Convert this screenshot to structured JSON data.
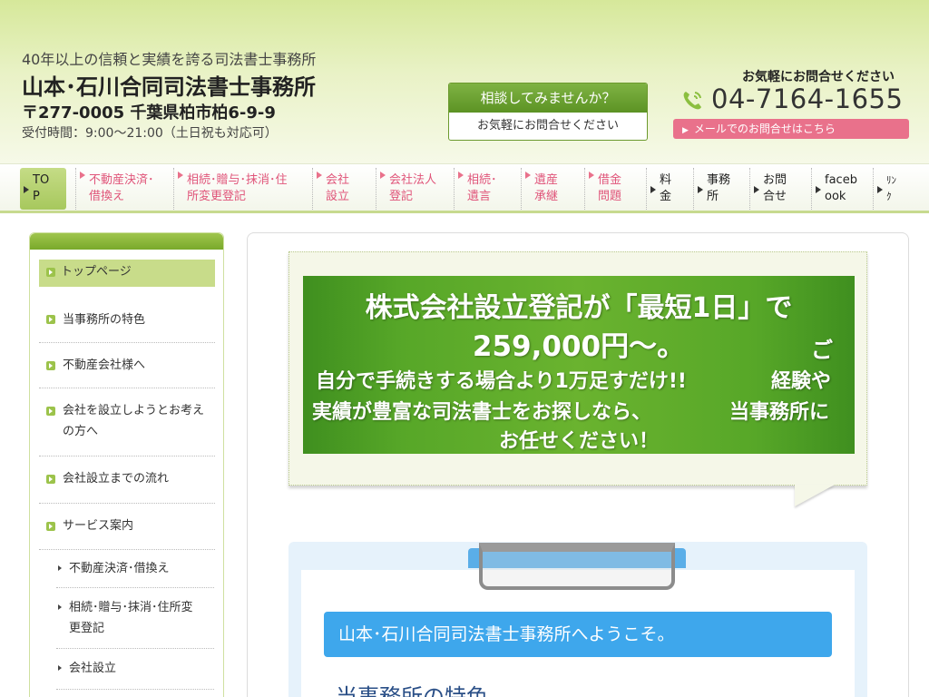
{
  "header": {
    "tagline": "40年以上の信頼と実績を誇る司法書士事務所",
    "title": "山本･石川合同司法書士事務所",
    "address": "〒277-0005 千葉県柏市柏6-9-9",
    "hours": "受付時間：9:00～21:00（土日祝も対応可）",
    "consult_top": "相談してみませんか？",
    "consult_bottom": "お気軽にお問合せください",
    "contact_label": "お気軽にお問合せください",
    "phone": "04-7164-1655",
    "mail_button": "メールでのお問合せはこちら"
  },
  "nav": {
    "items": [
      {
        "l1": "TO",
        "l2": "P"
      },
      {
        "l1": "不動産決済･",
        "l2": "借換え"
      },
      {
        "l1": "相続･贈与･抹消･住",
        "l2": "所変更登記"
      },
      {
        "l1": "会社",
        "l2": "設立"
      },
      {
        "l1": "会社法人",
        "l2": "登記"
      },
      {
        "l1": "相続･",
        "l2": "遺言"
      },
      {
        "l1": "遺産",
        "l2": "承継"
      },
      {
        "l1": "借金",
        "l2": "問題"
      },
      {
        "l1": "料",
        "l2": "金"
      },
      {
        "l1": "事務",
        "l2": "所"
      },
      {
        "l1": "お問",
        "l2": "合せ"
      },
      {
        "l1": "faceb",
        "l2": "ook"
      },
      {
        "l1": "ﾘﾝ",
        "l2": "ｸ"
      }
    ]
  },
  "sidebar": {
    "items": [
      {
        "label": "トップページ"
      },
      {
        "label": "当事務所の特色"
      },
      {
        "label": "不動産会社様へ"
      },
      {
        "l1": "会社を設立しようとお考え",
        "l2": "の方へ"
      },
      {
        "label": "会社設立までの流れ"
      },
      {
        "label": "サービス案内"
      }
    ],
    "sub_items": [
      {
        "label": "不動産決済･借換え"
      },
      {
        "l1": "相続･贈与･抹消･住所変",
        "l2": "更登記"
      },
      {
        "label": "会社設立"
      }
    ]
  },
  "banner": {
    "line1": "株式会社設立登記が「最短1日」で",
    "line2a": "259,000円～。",
    "line2b": "ご",
    "line3a": "自分で手続きする場合より1万足すだけ!!",
    "line3b": "経験や",
    "line4a": "実績が豊富な司法書士をお探しなら、",
    "line4b": "当事務所に",
    "line5": "お任せください！"
  },
  "main": {
    "welcome": "山本･石川合同司法書士事務所へようこそ。",
    "feature_heading": "当事務所の特色"
  },
  "colors": {
    "accent_green": "#6ab32f",
    "nav_pink": "#e0557a",
    "mail_pink": "#e9718b",
    "welcome_blue": "#3ea7ec"
  }
}
